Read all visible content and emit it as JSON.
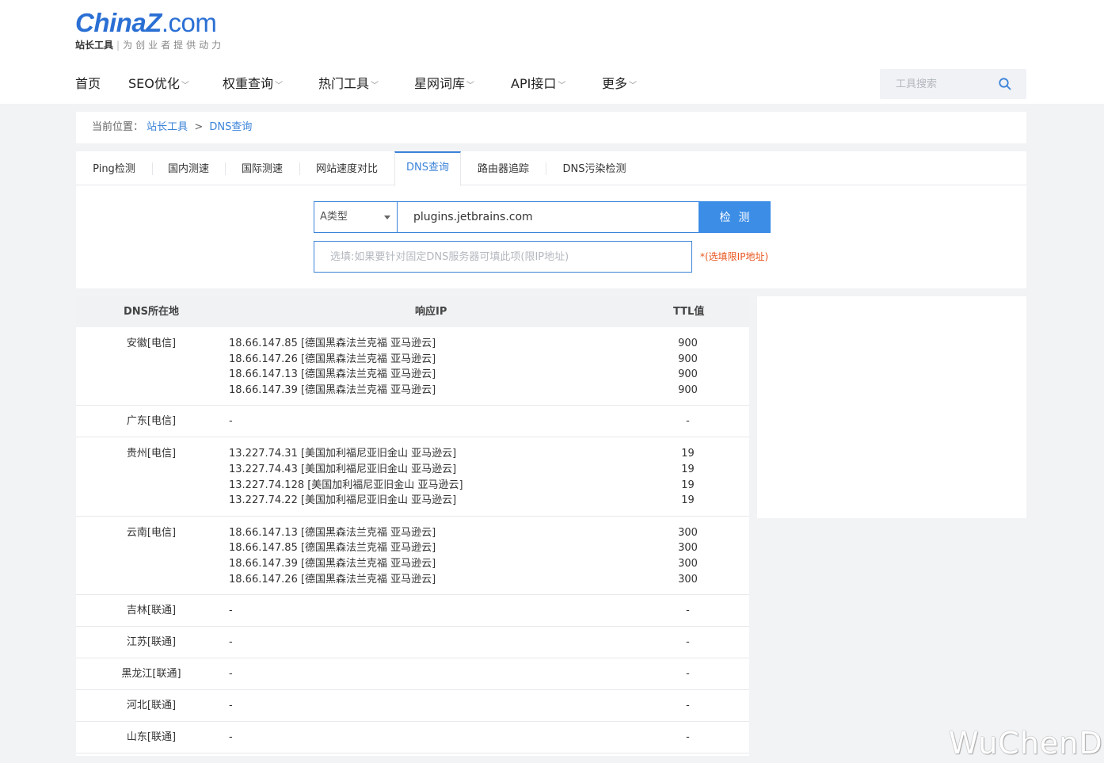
{
  "logo": {
    "main": "ChinaZ",
    "dot": ".com",
    "brand": "站长工具",
    "sep": "|",
    "slogan": "为创业者提供动力"
  },
  "nav": [
    {
      "label": "首页",
      "caret": ""
    },
    {
      "label": "SEO优化",
      "caret": "﹀"
    },
    {
      "label": "权重查询",
      "caret": "﹀"
    },
    {
      "label": "热门工具",
      "caret": "﹀"
    },
    {
      "label": "星网词库",
      "caret": "﹀"
    },
    {
      "label": "API接口",
      "caret": "﹀"
    },
    {
      "label": "更多",
      "caret": "﹀"
    }
  ],
  "search": {
    "placeholder": "工具搜索"
  },
  "breadcrumb": {
    "prefix": "当前位置：",
    "home": "站长工具",
    "sep": ">",
    "current": "DNS查询"
  },
  "tabs": [
    {
      "label": "Ping检测"
    },
    {
      "label": "国内测速"
    },
    {
      "label": "国际测速"
    },
    {
      "label": "网站速度对比"
    },
    {
      "label": "DNS查询"
    },
    {
      "label": "路由器追踪"
    },
    {
      "label": "DNS污染检测"
    }
  ],
  "form": {
    "type_selected": "A类型",
    "domain_value": "plugins.jetbrains.com",
    "check_label": "检测",
    "dns_placeholder": "选填:如果要针对固定DNS服务器可填此项(限IP地址)",
    "dns_hint": "*(选填限IP地址)"
  },
  "results": {
    "headers": {
      "location": "DNS所在地",
      "ip": "响应IP",
      "ttl": "TTL值"
    },
    "rows": [
      {
        "location": "安徽[电信]",
        "ips": [
          "18.66.147.85 [德国黑森法兰克福 亚马逊云]",
          "18.66.147.26 [德国黑森法兰克福 亚马逊云]",
          "18.66.147.13 [德国黑森法兰克福 亚马逊云]",
          "18.66.147.39 [德国黑森法兰克福 亚马逊云]"
        ],
        "ttls": [
          "900",
          "900",
          "900",
          "900"
        ]
      },
      {
        "location": "广东[电信]",
        "ips": [
          "-"
        ],
        "ttls": [
          "-"
        ]
      },
      {
        "location": "贵州[电信]",
        "ips": [
          "13.227.74.31 [美国加利福尼亚旧金山 亚马逊云]",
          "13.227.74.43 [美国加利福尼亚旧金山 亚马逊云]",
          "13.227.74.128 [美国加利福尼亚旧金山 亚马逊云]",
          "13.227.74.22 [美国加利福尼亚旧金山 亚马逊云]"
        ],
        "ttls": [
          "19",
          "19",
          "19",
          "19"
        ]
      },
      {
        "location": "云南[电信]",
        "ips": [
          "18.66.147.13 [德国黑森法兰克福 亚马逊云]",
          "18.66.147.85 [德国黑森法兰克福 亚马逊云]",
          "18.66.147.39 [德国黑森法兰克福 亚马逊云]",
          "18.66.147.26 [德国黑森法兰克福 亚马逊云]"
        ],
        "ttls": [
          "300",
          "300",
          "300",
          "300"
        ]
      },
      {
        "location": "吉林[联通]",
        "ips": [
          "-"
        ],
        "ttls": [
          "-"
        ]
      },
      {
        "location": "江苏[联通]",
        "ips": [
          "-"
        ],
        "ttls": [
          "-"
        ]
      },
      {
        "location": "黑龙江[联通]",
        "ips": [
          "-"
        ],
        "ttls": [
          "-"
        ]
      },
      {
        "location": "河北[联通]",
        "ips": [
          "-"
        ],
        "ttls": [
          "-"
        ]
      },
      {
        "location": "山东[联通]",
        "ips": [
          "-"
        ],
        "ttls": [
          "-"
        ]
      }
    ]
  },
  "watermark": "WuChenDi",
  "colors": {
    "accent": "#3b83d9",
    "button": "#3b8de6",
    "hint": "#e8541e",
    "background": "#f2f3f5"
  }
}
